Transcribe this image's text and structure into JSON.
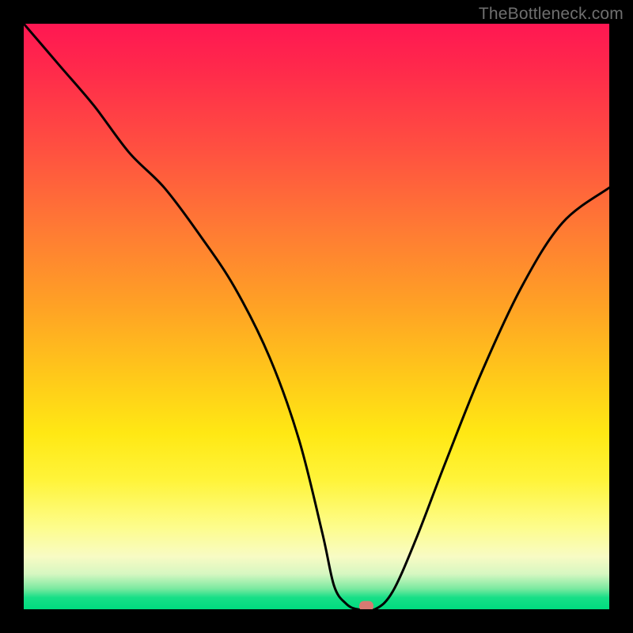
{
  "watermark": "TheBottleneck.com",
  "chart_data": {
    "type": "line",
    "title": "",
    "xlabel": "",
    "ylabel": "",
    "xlim": [
      0,
      100
    ],
    "ylim": [
      0,
      100
    ],
    "grid": false,
    "legend": false,
    "series": [
      {
        "name": "bottleneck-curve",
        "x": [
          0,
          6,
          12,
          18,
          24,
          30,
          36,
          42,
          47,
          51,
          53,
          55,
          57,
          60,
          63,
          67,
          72,
          78,
          85,
          92,
          100
        ],
        "values": [
          100,
          93,
          86,
          78,
          72,
          64,
          55,
          43,
          29,
          13,
          4,
          1,
          0,
          0,
          3,
          12,
          25,
          40,
          55,
          66,
          72
        ]
      }
    ],
    "marker": {
      "x": 58.5,
      "y": 0.6
    },
    "background_gradient": {
      "direction": "vertical",
      "stops": [
        {
          "pos": 0,
          "color": "#ff1752"
        },
        {
          "pos": 0.35,
          "color": "#ff7a34"
        },
        {
          "pos": 0.7,
          "color": "#ffe814"
        },
        {
          "pos": 0.91,
          "color": "#f8fbc4"
        },
        {
          "pos": 1.0,
          "color": "#00db7f"
        }
      ]
    }
  }
}
